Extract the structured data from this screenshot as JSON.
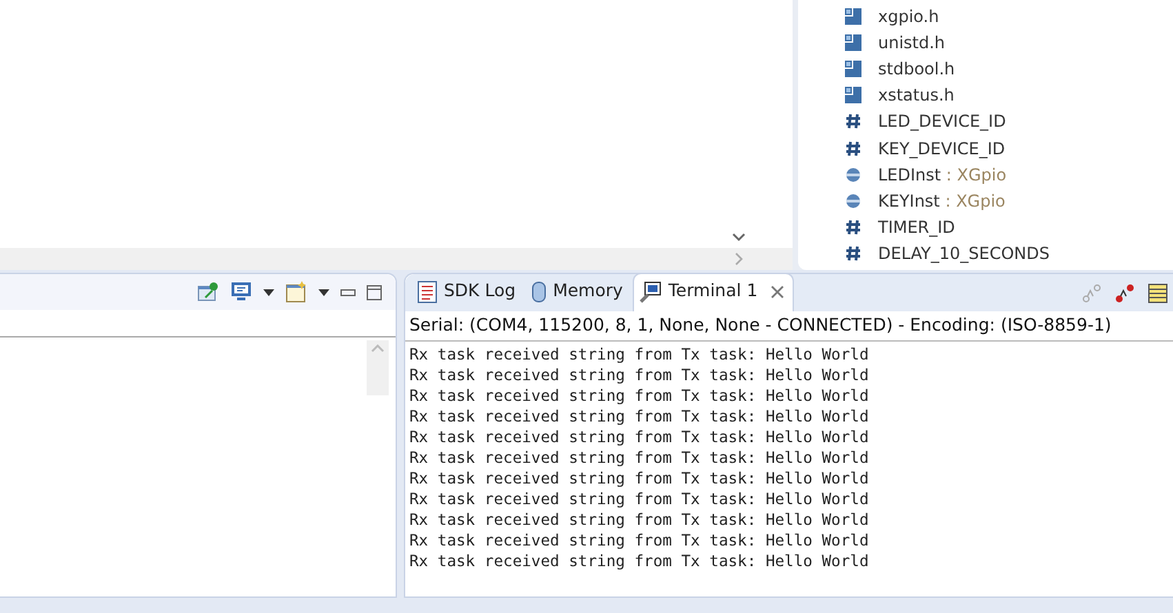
{
  "outline": {
    "items": [
      {
        "kind": "include",
        "label": "xgpio.h"
      },
      {
        "kind": "include",
        "label": "unistd.h"
      },
      {
        "kind": "include",
        "label": "stdbool.h"
      },
      {
        "kind": "include",
        "label": "xstatus.h"
      },
      {
        "kind": "macro",
        "label": "LED_DEVICE_ID"
      },
      {
        "kind": "macro",
        "label": "KEY_DEVICE_ID"
      },
      {
        "kind": "variable",
        "label": "LEDInst",
        "type": " : XGpio"
      },
      {
        "kind": "variable",
        "label": "KEYInst",
        "type": " : XGpio"
      },
      {
        "kind": "macro",
        "label": "TIMER_ID"
      },
      {
        "kind": "macro",
        "label": "DELAY_10_SECONDS"
      }
    ]
  },
  "terminal": {
    "tabs": [
      {
        "kind": "log",
        "label": "SDK Log",
        "selected": false
      },
      {
        "kind": "memory",
        "label": "Memory",
        "selected": false
      },
      {
        "kind": "terminal",
        "label": "Terminal 1",
        "selected": true
      }
    ],
    "status": "Serial: (COM4, 115200, 8, 1, None, None - CONNECTED) - Encoding: (ISO-8859-1)",
    "lines": [
      "Rx task received string from Tx task: Hello World",
      "Rx task received string from Tx task: Hello World",
      "Rx task received string from Tx task: Hello World",
      "Rx task received string from Tx task: Hello World",
      "Rx task received string from Tx task: Hello World",
      "Rx task received string from Tx task: Hello World",
      "Rx task received string from Tx task: Hello World",
      "Rx task received string from Tx task: Hello World",
      "Rx task received string from Tx task: Hello World",
      "Rx task received string from Tx task: Hello World",
      "Rx task received string from Tx task: Hello World"
    ]
  }
}
